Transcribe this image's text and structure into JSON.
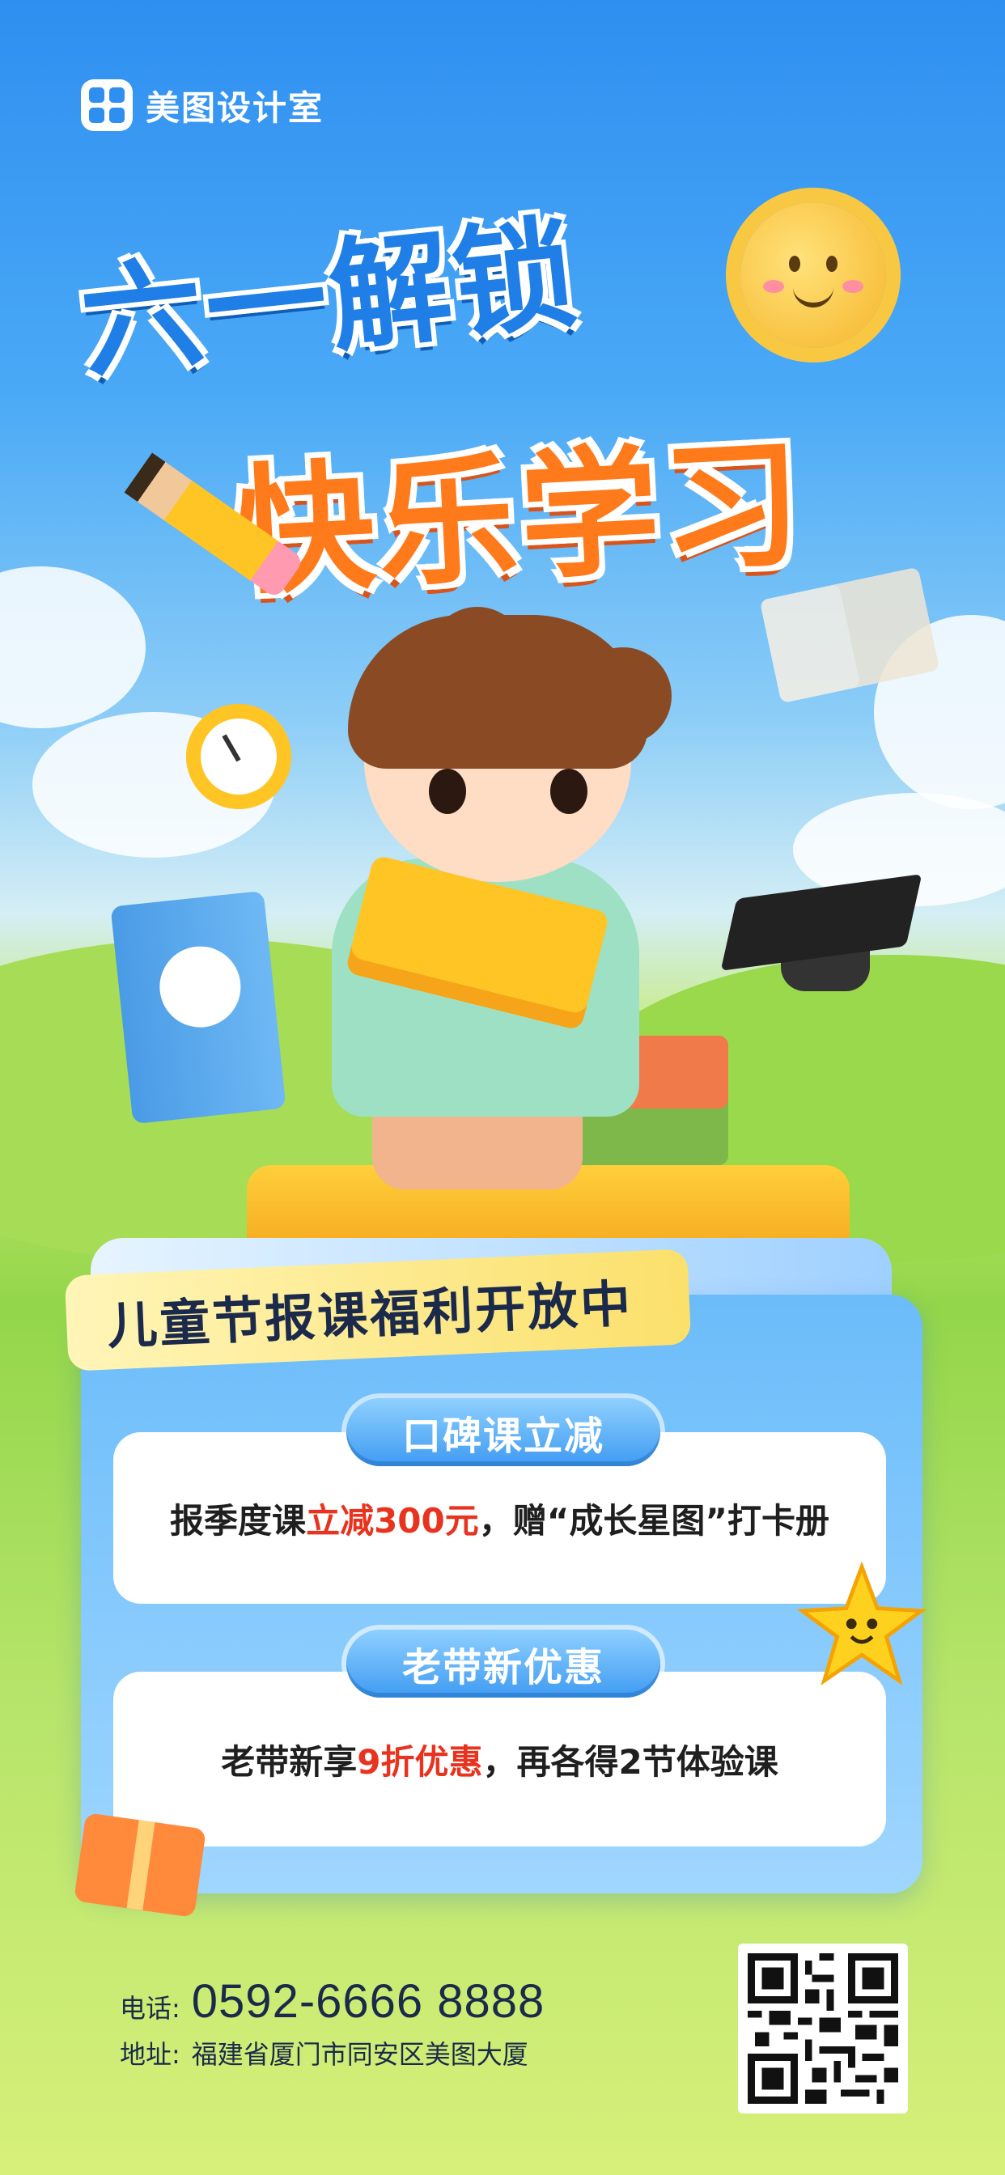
{
  "brand": {
    "name": "美图设计室"
  },
  "headline": {
    "line1": "六一解锁",
    "line2": "快乐学习"
  },
  "banner": {
    "text": "儿童节报课福利开放中"
  },
  "offers": [
    {
      "tag": "口碑课立减",
      "prefix": "报季度课",
      "highlight": "立减300元",
      "suffix": "，赠“成长星图”打卡册"
    },
    {
      "tag": "老带新优惠",
      "prefix": "老带新享",
      "highlight": "9折优惠",
      "suffix": "，再各得2节体验课"
    }
  ],
  "contact": {
    "phone_label": "电话:",
    "phone": "0592-6666 8888",
    "address_label": "地址:",
    "address": "福建省厦门市同安区美图大厦"
  },
  "colors": {
    "accent_blue": "#1f7fe6",
    "accent_orange": "#ff7a1a",
    "highlight_red": "#e8331f",
    "banner_yellow": "#fbe06b"
  },
  "icons": [
    "meitu-logo-icon",
    "sun-icon",
    "pencil-icon",
    "alarm-clock-icon",
    "open-book-icon",
    "book-character-icon",
    "graduation-cap-icon",
    "star-character-icon",
    "gift-box-icon",
    "qr-code-icon"
  ]
}
